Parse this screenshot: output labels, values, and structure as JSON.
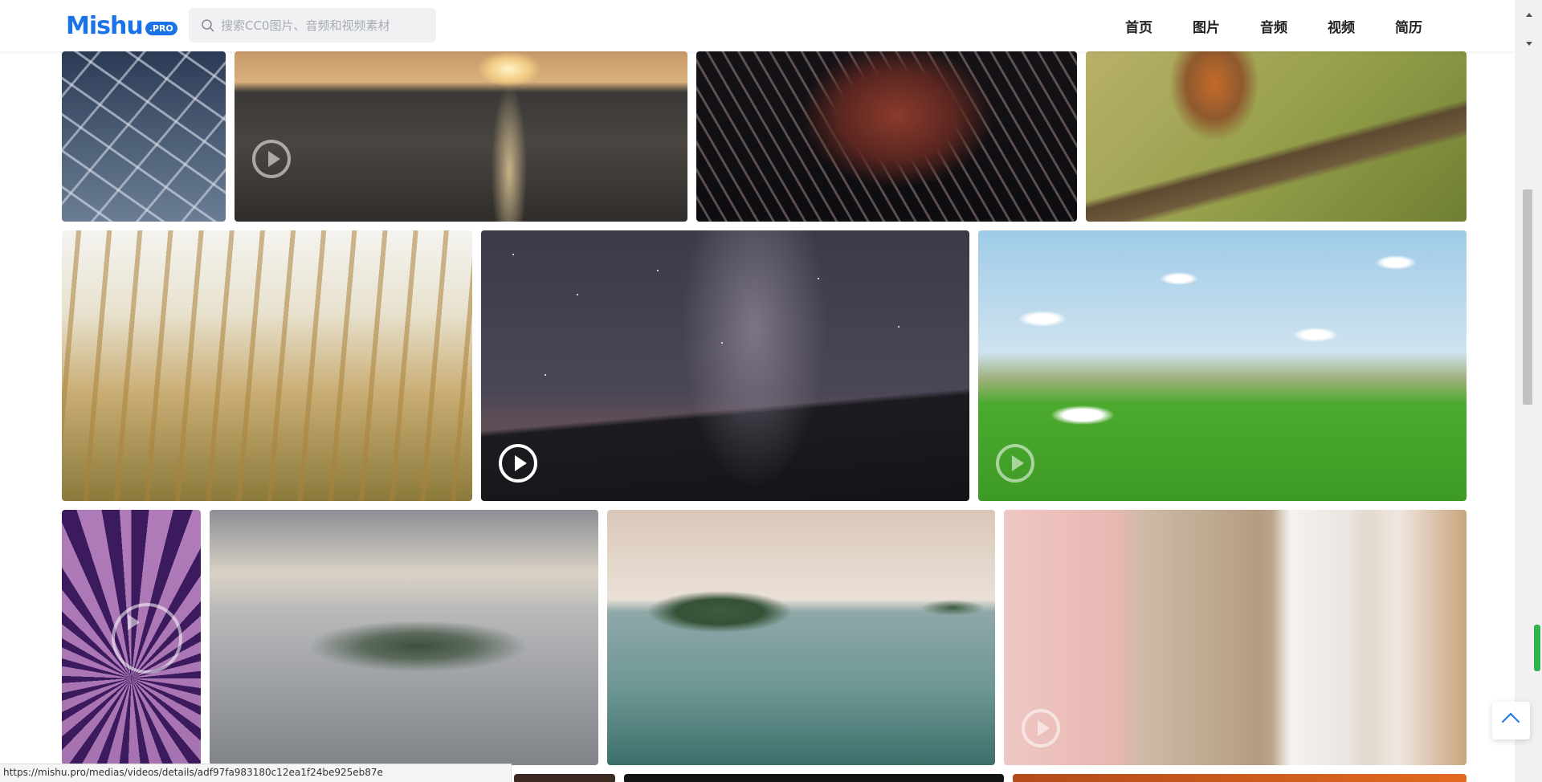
{
  "header": {
    "logo": {
      "text": "Mishu",
      "badge": ".PRO"
    },
    "search": {
      "placeholder": "搜索CC0图片、音频和视频素材",
      "value": ""
    },
    "nav": [
      {
        "label": "首页"
      },
      {
        "label": "图片"
      },
      {
        "label": "音频"
      },
      {
        "label": "视频"
      },
      {
        "label": "简历"
      }
    ]
  },
  "gallery": {
    "tiles": [
      {
        "subject": "cracked salt flat",
        "type": "image"
      },
      {
        "subject": "sunset over the sea",
        "type": "video"
      },
      {
        "subject": "lionfish",
        "type": "image"
      },
      {
        "subject": "bird on a branch",
        "type": "image"
      },
      {
        "subject": "wheat field",
        "type": "image"
      },
      {
        "subject": "milky way over mountains",
        "type": "video"
      },
      {
        "subject": "egrets over green fields",
        "type": "video"
      },
      {
        "subject": "purple flower",
        "type": "video"
      },
      {
        "subject": "misty island aerial",
        "type": "image"
      },
      {
        "subject": "lake with pier",
        "type": "image"
      },
      {
        "subject": "hand touching white wall",
        "type": "video"
      }
    ]
  },
  "status_bar": {
    "url": "https://mishu.pro/medias/videos/details/adf97fa983180c12ea1f24be925eb87e"
  },
  "colors": {
    "brand": "#1a73e8",
    "scroll_indicator": "#2fb24f"
  }
}
